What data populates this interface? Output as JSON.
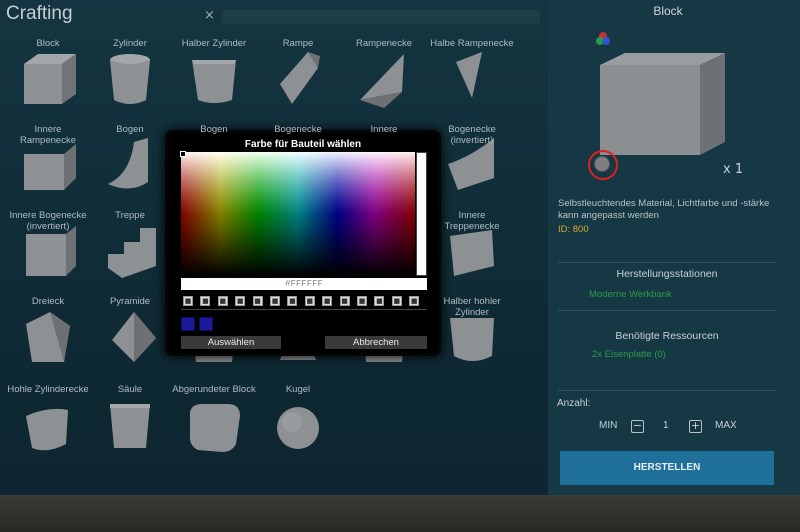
{
  "header": {
    "title": "Crafting",
    "close_glyph": "×"
  },
  "items": [
    {
      "label": "Block",
      "shape": "cube"
    },
    {
      "label": "Zylinder",
      "shape": "cylinder"
    },
    {
      "label": "Halber Zylinder",
      "shape": "halfcyl"
    },
    {
      "label": "Rampe",
      "shape": "ramp"
    },
    {
      "label": "Rampenecke",
      "shape": "rampcorner"
    },
    {
      "label": "Halbe Rampenecke",
      "shape": "halframpcorner"
    },
    {
      "label": "Innere Rampenecke",
      "shape": "innerramp"
    },
    {
      "label": "Bogen",
      "shape": "arch"
    },
    {
      "label": "Bogen",
      "shape": "arch"
    },
    {
      "label": "Bogenecke",
      "shape": "archcorner"
    },
    {
      "label": "Innere",
      "shape": "innerarch"
    },
    {
      "label": "Bogenecke (invertiert)",
      "shape": "archinv"
    },
    {
      "label": "Innere Bogenecke (invertiert)",
      "shape": "innerarchinv"
    },
    {
      "label": "Treppe",
      "shape": "stairs"
    },
    {
      "label": "",
      "shape": "stairs2"
    },
    {
      "label": "",
      "shape": "stairs3"
    },
    {
      "label": "",
      "shape": "stairs4"
    },
    {
      "label": "Innere Treppenecke",
      "shape": "innerstairs"
    },
    {
      "label": "Dreieck",
      "shape": "triangle"
    },
    {
      "label": "Pyramide",
      "shape": "pyramid"
    },
    {
      "label": "",
      "shape": "hollow1"
    },
    {
      "label": "",
      "shape": "cone"
    },
    {
      "label": "",
      "shape": "hollow2"
    },
    {
      "label": "Halber hohler Zylinder",
      "shape": "halfhollow"
    },
    {
      "label": "Hohle Zylinderecke",
      "shape": "hollowcorner"
    },
    {
      "label": "Säule",
      "shape": "column"
    },
    {
      "label": "Abgerundeter Block",
      "shape": "roundedblock"
    },
    {
      "label": "Kugel",
      "shape": "sphere"
    }
  ],
  "detail": {
    "title": "Block",
    "quantity_text": "x 1",
    "description": "Selbstleuchtendes Material, Lichtfarbe und -stärke kann angepasst werden",
    "id_text": "ID: 800",
    "stations_heading": "Herstellungsstationen",
    "station": "Moderne Werkbank",
    "resources_heading": "Benötigte Ressourcen",
    "resource": "2x Eisenplatte  (0)",
    "amount_label": "Anzahl:",
    "min_label": "MIN",
    "minus": "−",
    "amount_value": "1",
    "plus": "+",
    "max_label": "MAX",
    "craft_button": "HERSTELLEN"
  },
  "color_picker": {
    "title": "Farbe für Bauteil wählen",
    "hex_value": "#FFFFFF",
    "slot_count": 14,
    "history_colors": [
      "#1a1a9a",
      "#1a1a9a"
    ],
    "select_button": "Auswählen",
    "cancel_button": "Abbrechen"
  },
  "colors": {
    "accent": "#1e6f99",
    "green": "#2e9a46",
    "id": "#d9a82a",
    "highlight_ring": "#e02020"
  }
}
